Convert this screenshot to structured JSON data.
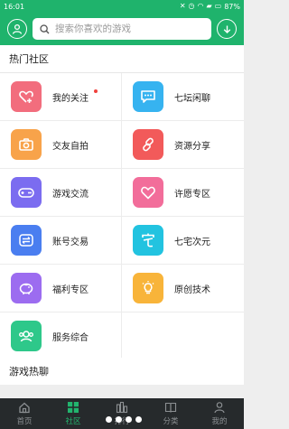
{
  "status_bar": {
    "time": "16:01",
    "battery": "87%"
  },
  "header": {
    "search_placeholder": "搜索你喜欢的游戏"
  },
  "hot": {
    "title": "热门社区",
    "items": [
      {
        "label": "我的关注",
        "color": "#f26d7d",
        "icon": "heart-plus-icon",
        "badge": true
      },
      {
        "label": "七坛闲聊",
        "color": "#36b3f0",
        "icon": "chat-bubble-icon"
      },
      {
        "label": "交友自拍",
        "color": "#f8a34a",
        "icon": "camera-icon"
      },
      {
        "label": "资源分享",
        "color": "#f25a5a",
        "icon": "link-icon"
      },
      {
        "label": "游戏交流",
        "color": "#7b6cf0",
        "icon": "gamepad-icon"
      },
      {
        "label": "许愿专区",
        "color": "#f26d9a",
        "icon": "heart-icon"
      },
      {
        "label": "账号交易",
        "color": "#4a7ef0",
        "icon": "exchange-icon"
      },
      {
        "label": "七宅次元",
        "color": "#22c3e0",
        "icon": "zhai-icon"
      },
      {
        "label": "福利专区",
        "color": "#9c6cf0",
        "icon": "piggy-bank-icon"
      },
      {
        "label": "原创技术",
        "color": "#f8b43a",
        "icon": "lightbulb-icon"
      },
      {
        "label": "服务综合",
        "color": "#2ec88a",
        "icon": "users-icon"
      }
    ]
  },
  "game_chat": {
    "title": "游戏热聊"
  },
  "tabs": [
    {
      "label": "首页",
      "icon": "home-icon",
      "active": false
    },
    {
      "label": "社区",
      "icon": "grid-icon",
      "active": true
    },
    {
      "label": "排行",
      "icon": "bar-chart-icon",
      "active": false
    },
    {
      "label": "分类",
      "icon": "book-icon",
      "active": false
    },
    {
      "label": "我的",
      "icon": "person-icon",
      "active": false
    }
  ],
  "colors": {
    "brand": "#1fb36c",
    "tabbar": "#262a2c",
    "active_tab": "#22b46e"
  }
}
